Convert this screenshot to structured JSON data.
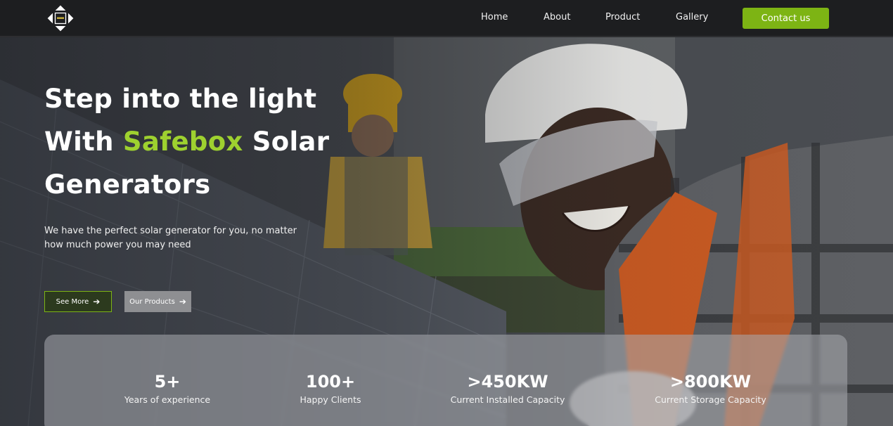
{
  "nav": {
    "links": [
      "Home",
      "About",
      "Product",
      "Gallery"
    ],
    "contact_label": "Contact us"
  },
  "hero": {
    "headline_line1": "Step into the light",
    "headline_with": "With ",
    "headline_brand": "Safebox",
    "headline_solar": " Solar",
    "headline_line3": "Generators",
    "subtext": "We have the perfect solar generator for you, no matter how much power you may need",
    "see_more_label": "See More",
    "our_products_label": "Our Products"
  },
  "stats": [
    {
      "value": "5+",
      "label": "Years of experience"
    },
    {
      "value": "100+",
      "label": "Happy Clients"
    },
    {
      "value": ">450KW",
      "label": "Current Installed Capacity"
    },
    {
      "value": ">800KW",
      "label": "Current Storage Capacity"
    }
  ],
  "colors": {
    "accent": "#7db414",
    "brand_text": "#9ed12f",
    "navbar": "#1d1e20"
  },
  "icons": {
    "logo": "diamond-logo-icon",
    "arrow": "arrow-right-icon"
  }
}
